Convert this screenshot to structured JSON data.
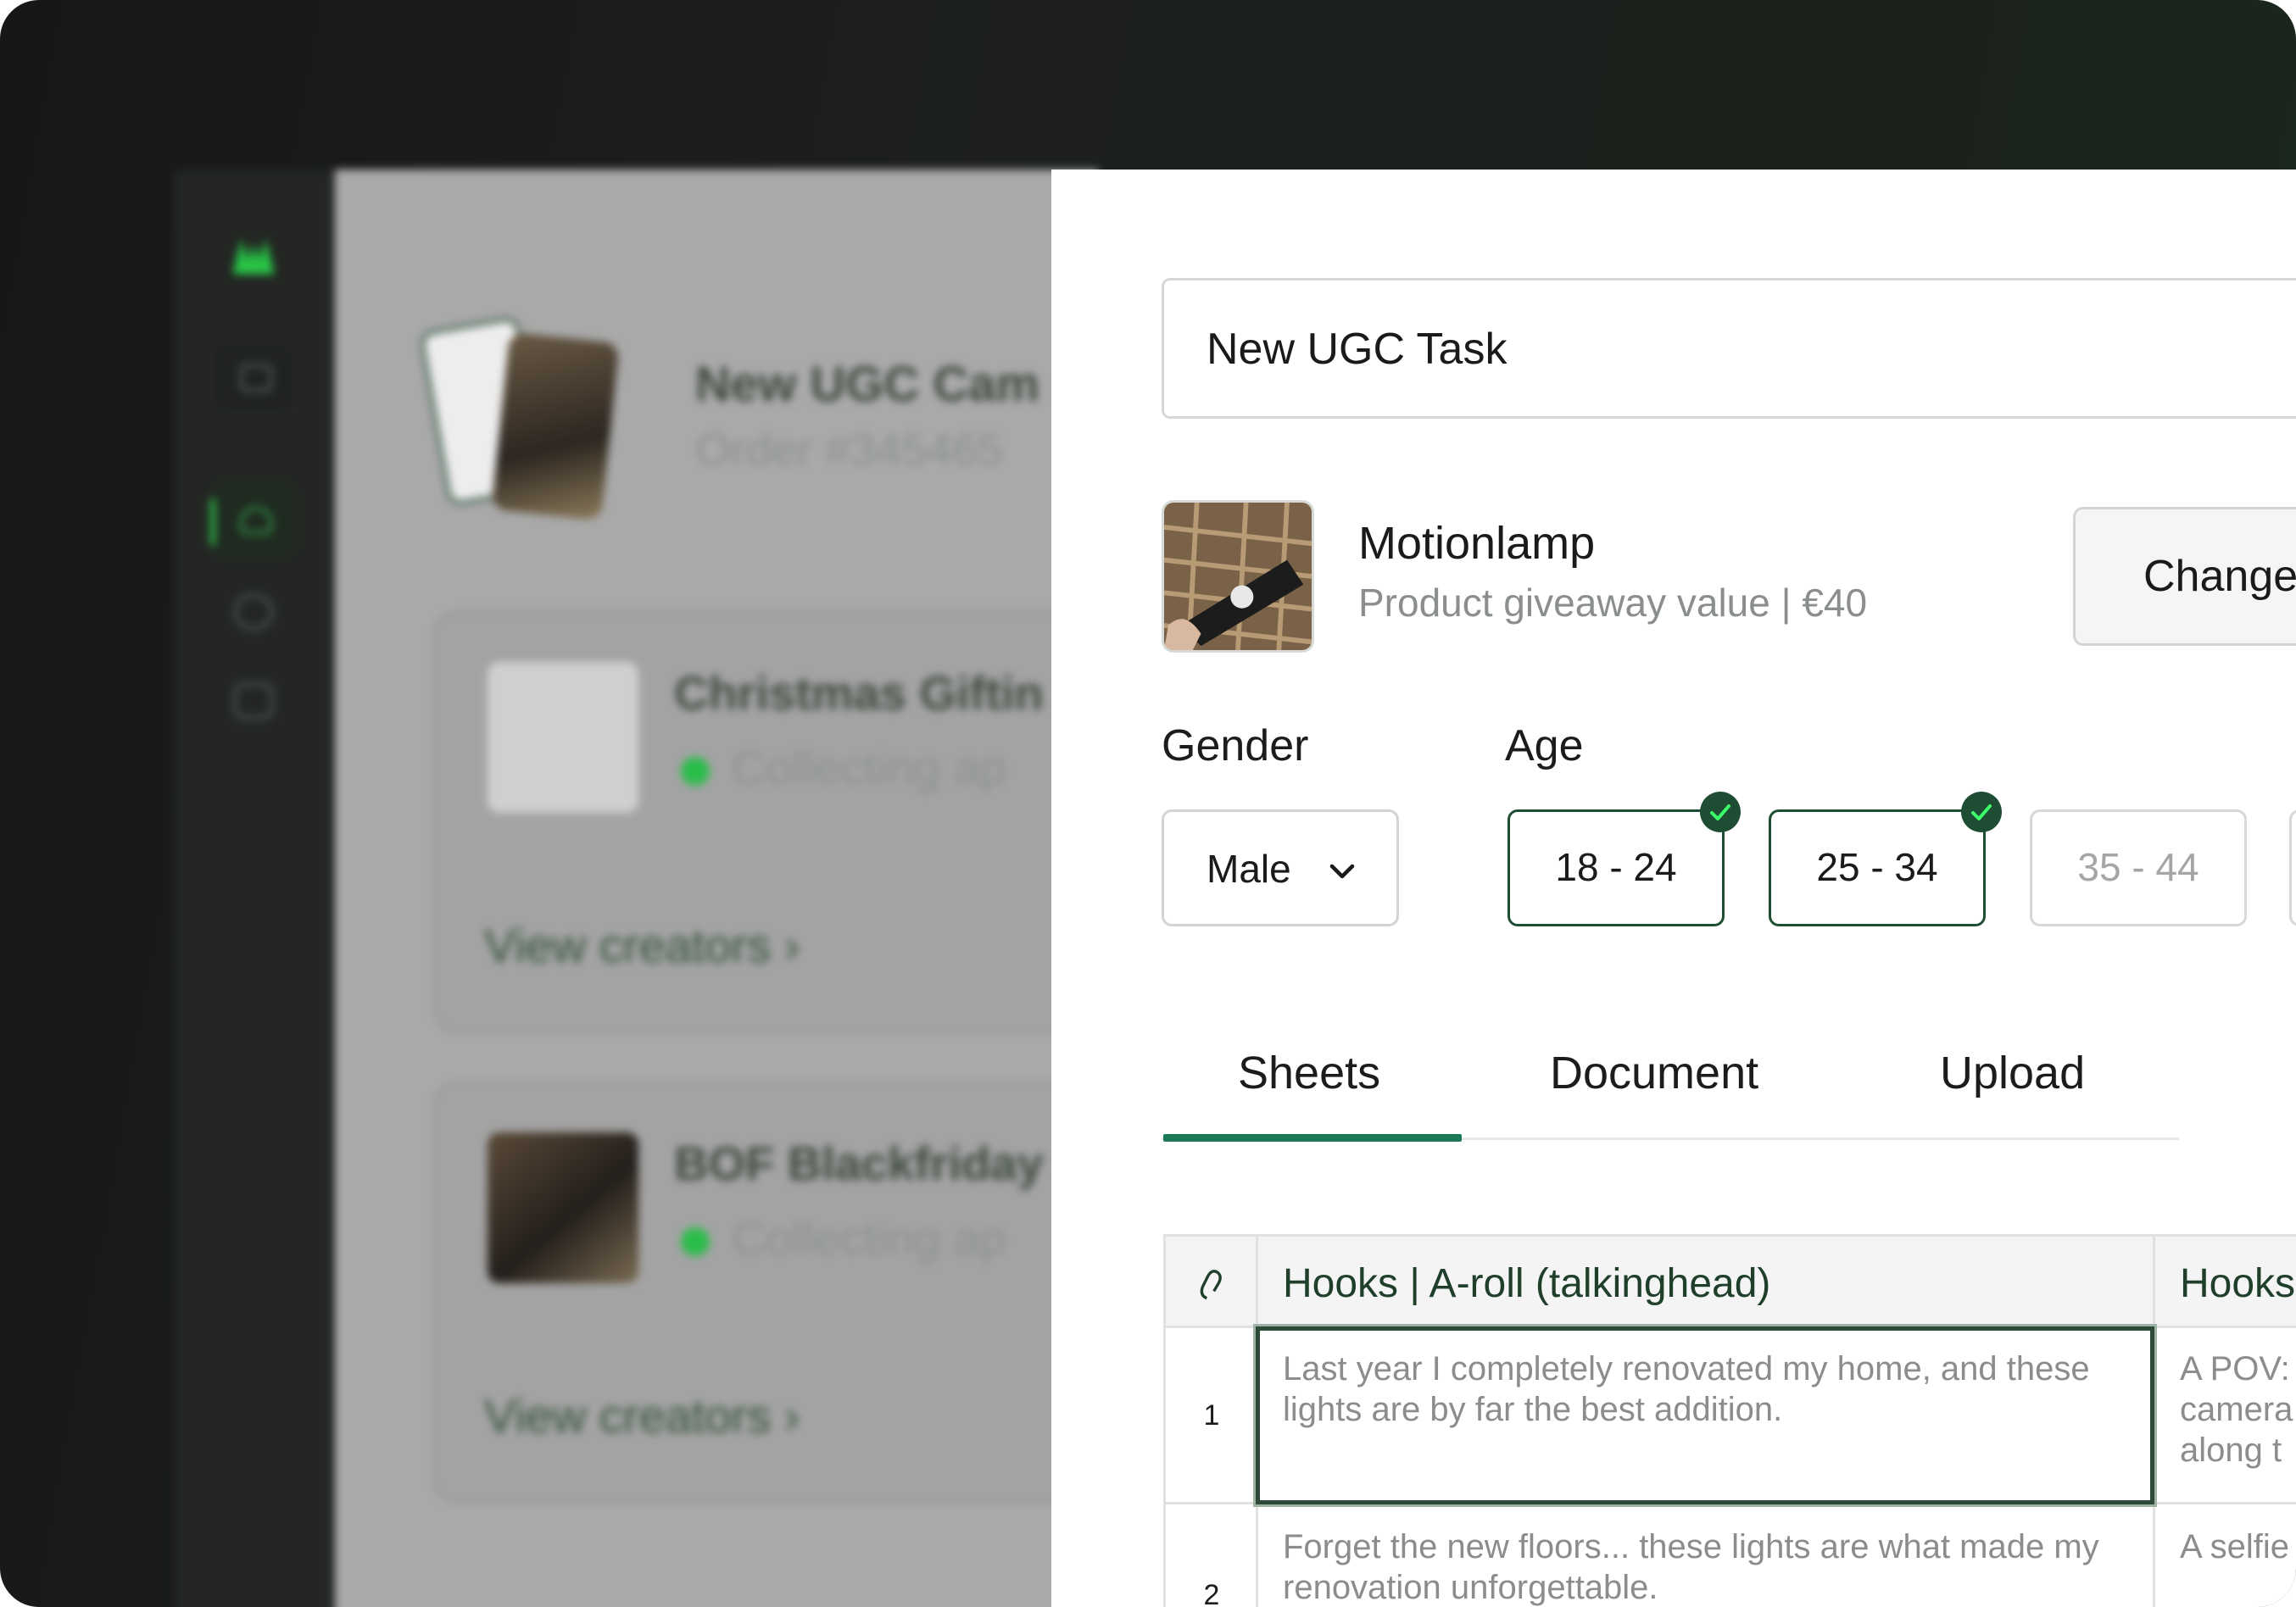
{
  "background": {
    "campaign_title": "New UGC Cam",
    "campaign_sub": "Order #345465",
    "panels": [
      {
        "title": "Christmas Giftin",
        "status": "Collecting ap",
        "link": "View creators ›"
      },
      {
        "title": "BOF Blackfriday",
        "status": "Collecting ap",
        "link": "View creators ›"
      }
    ]
  },
  "task": {
    "title_value": "New UGC Task"
  },
  "product": {
    "name": "Motionlamp",
    "meta": "Product giveaway value | €40",
    "change_label": "Change"
  },
  "gender": {
    "label": "Gender",
    "value": "Male"
  },
  "age": {
    "label": "Age",
    "options": [
      {
        "label": "18 - 24",
        "selected": true
      },
      {
        "label": "25 - 34",
        "selected": true
      },
      {
        "label": "35 - 44",
        "selected": false
      }
    ]
  },
  "tabs": [
    {
      "label": "Sheets",
      "active": true
    },
    {
      "label": "Document",
      "active": false
    },
    {
      "label": "Upload",
      "active": false
    }
  ],
  "sheet": {
    "columns": [
      "Hooks | A-roll (talkinghead)",
      "Hooks"
    ],
    "rows": [
      {
        "num": "1",
        "cells": [
          "Last year I completely renovated my home, and these lights are by far the best addition.",
          "A POV: camera along t"
        ]
      },
      {
        "num": "2",
        "cells": [
          "Forget the new floors... these lights are what made my renovation unforgettable.",
          "A selfie"
        ]
      }
    ]
  },
  "colors": {
    "accent": "#1b7a55",
    "selected_border": "#1e4d33",
    "status_green": "#2bbd4a"
  },
  "icons": {
    "dropdown": "chevron-down-icon",
    "selected": "check-icon",
    "sheet_corner": "link-icon"
  }
}
